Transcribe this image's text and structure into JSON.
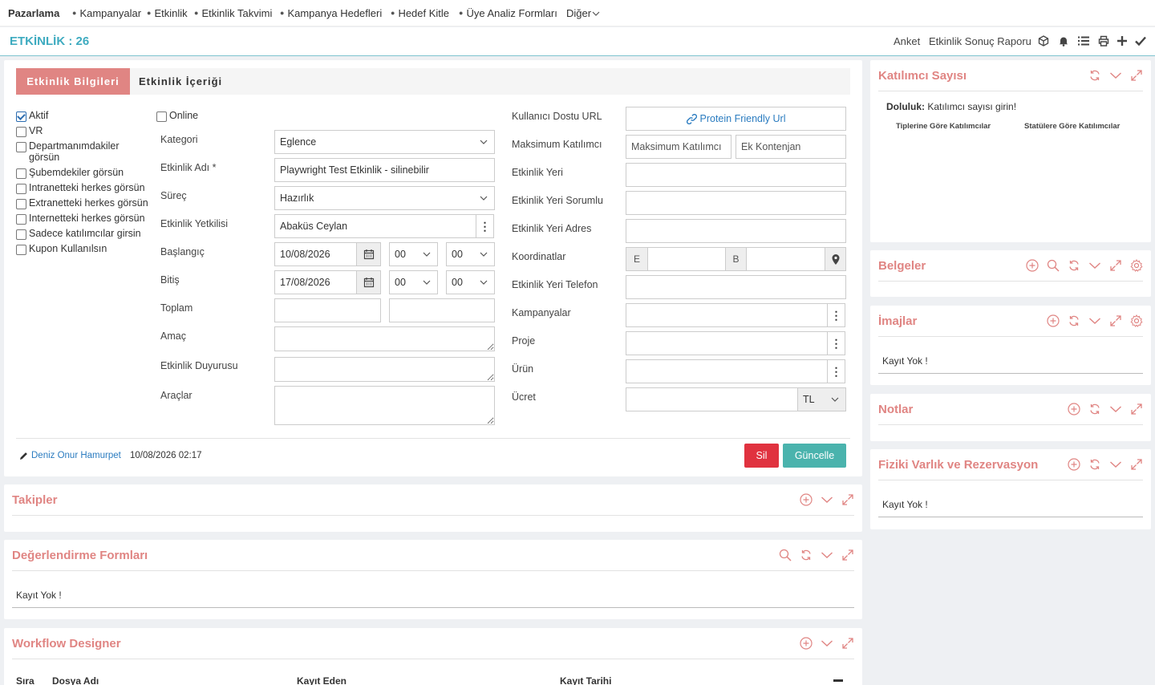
{
  "nav": {
    "brand": "Pazarlama",
    "items": [
      "Kampanyalar",
      "Etkinlik",
      "Etkinlik Takvimi",
      "Kampanya Hedefleri",
      "Hedef Kitle",
      "Üye Analiz Formları"
    ],
    "more": "Diğer"
  },
  "titlebar": {
    "title": "ETKİNLİK : 26",
    "links": [
      "Anket",
      "Etkinlik Sonuç Raporu"
    ],
    "icons": [
      "cube-icon",
      "bell-icon",
      "list-icon",
      "print-icon",
      "plus-icon",
      "check-icon"
    ]
  },
  "colors": {
    "accent": "#e08583",
    "teal": "#3eabc0",
    "delete": "#e0323f",
    "update": "#4ab3ad",
    "link": "#2b7cc0"
  },
  "tabs": {
    "active": "Etkinlik Bilgileri",
    "inactive": "Etkinlik İçeriği"
  },
  "checkboxes": [
    {
      "label": "Aktif",
      "checked": true
    },
    {
      "label": "VR",
      "checked": false
    },
    {
      "label": "Departmanımdakiler görsün",
      "checked": false
    },
    {
      "label": "Şubemdekiler görsün",
      "checked": false
    },
    {
      "label": "Intranetteki herkes görsün",
      "checked": false
    },
    {
      "label": "Extranetteki herkes görsün",
      "checked": false
    },
    {
      "label": "Internetteki herkes görsün",
      "checked": false
    },
    {
      "label": "Sadece katılımcılar girsin",
      "checked": false
    },
    {
      "label": "Kupon Kullanılsın",
      "checked": false
    }
  ],
  "online": {
    "label": "Online",
    "checked": false
  },
  "form": {
    "kategori": {
      "label": "Kategori",
      "value": "Eglence"
    },
    "etkinlik_adi": {
      "label": "Etkinlik Adı *",
      "value": "Playwright Test Etkinlik - silinebilir"
    },
    "surec": {
      "label": "Süreç",
      "value": "Hazırlık"
    },
    "yetkili": {
      "label": "Etkinlik Yetkilisi",
      "value": "Abaküs Ceylan"
    },
    "baslangic": {
      "label": "Başlangıç",
      "date": "10/08/2026",
      "hour": "00",
      "minute": "00"
    },
    "bitis": {
      "label": "Bitiş",
      "date": "17/08/2026",
      "hour": "00",
      "minute": "00"
    },
    "toplam": {
      "label": "Toplam"
    },
    "amac": {
      "label": "Amaç"
    },
    "duyuru": {
      "label": "Etkinlik Duyurusu"
    },
    "araclar": {
      "label": "Araçlar"
    }
  },
  "form_right": {
    "url": {
      "label": "Kullanıcı Dostu URL",
      "button": "Protein Friendly Url"
    },
    "max": {
      "label": "Maksimum Katılımcı",
      "placeholder1": "Maksimum Katılımcı",
      "placeholder2": "Ek Kontenjan"
    },
    "yer": {
      "label": "Etkinlik Yeri"
    },
    "sorumlu": {
      "label": "Etkinlik Yeri Sorumlu"
    },
    "adres": {
      "label": "Etkinlik Yeri Adres"
    },
    "koordinat": {
      "label": "Koordinatlar",
      "e": "E",
      "b": "B"
    },
    "telefon": {
      "label": "Etkinlik Yeri Telefon"
    },
    "kampanyalar": {
      "label": "Kampanyalar"
    },
    "proje": {
      "label": "Proje"
    },
    "urun": {
      "label": "Ürün"
    },
    "ucret": {
      "label": "Ücret",
      "currency": "TL"
    }
  },
  "footer": {
    "user": "Deniz Onur Hamurpet",
    "datetime": "10/08/2026 02:17",
    "delete": "Sil",
    "update": "Güncelle"
  },
  "panels": {
    "takipler": {
      "title": "Takipler"
    },
    "degerlendirme": {
      "title": "Değerlendirme Formları",
      "empty": "Kayıt Yok !"
    },
    "workflow": {
      "title": "Workflow Designer",
      "columns": [
        "Sıra",
        "Dosya Adı",
        "Kayıt Eden",
        "Kayıt Tarihi"
      ]
    },
    "katilimci": {
      "title": "Katılımcı Sayısı",
      "doluluk_label": "Doluluk:",
      "doluluk_text": "Katılımcı sayısı girin!",
      "col1": "Tiplerine Göre Katılımcılar",
      "col2": "Statülere Göre Katılımcılar"
    },
    "belgeler": {
      "title": "Belgeler"
    },
    "imajlar": {
      "title": "İmajlar",
      "empty": "Kayıt Yok !"
    },
    "notlar": {
      "title": "Notlar"
    },
    "fiziki": {
      "title": "Fiziki Varlık ve Rezervasyon",
      "empty": "Kayıt Yok !"
    }
  }
}
